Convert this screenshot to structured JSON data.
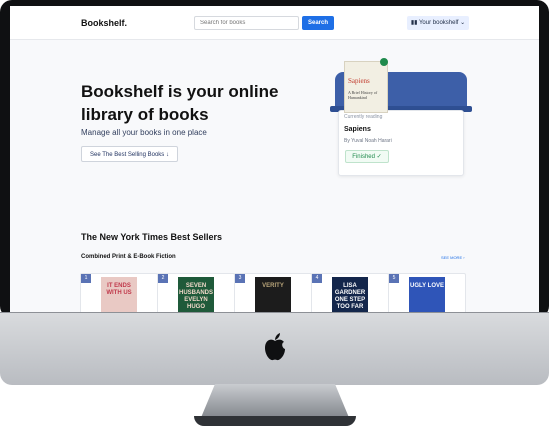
{
  "nav": {
    "logo": "Bookshelf.",
    "search_placeholder": "Search for books",
    "search_button": "Search",
    "account_label": "Your bookshelf"
  },
  "hero": {
    "title": "Bookshelf is your online library of books",
    "subtitle": "Manage all your books in one place",
    "cta": "See The Best Selling Books"
  },
  "currently_reading": {
    "label": "Currently reading",
    "title": "Sapiens",
    "author": "By Yuval Noah Harari",
    "status": "Finished",
    "cover_title": "Sapiens",
    "cover_subtitle": "A Brief History of Humankind"
  },
  "best_sellers": {
    "heading": "The New York Times Best Sellers",
    "list_name": "Combined Print & E-Book Fiction",
    "see_more": "SEE MORE",
    "books": [
      {
        "rank": "1",
        "cover_text": "IT ENDS WITH US",
        "bg": "#e9c9c4",
        "fg": "#c0394b"
      },
      {
        "rank": "2",
        "cover_text": "SEVEN HUSBANDS EVELYN HUGO",
        "bg": "#1f5a3a",
        "fg": "#f0d8c9"
      },
      {
        "rank": "3",
        "cover_text": "VERITY",
        "bg": "#1c1c1c",
        "fg": "#b9a57a"
      },
      {
        "rank": "4",
        "cover_text": "LISA GARDNER ONE STEP TOO FAR",
        "bg": "#13264b",
        "fg": "#ffffff"
      },
      {
        "rank": "5",
        "cover_text": "UGLY LOVE",
        "bg": "#2f55b8",
        "fg": "#ffffff"
      }
    ]
  },
  "colors": {
    "accent": "#1e6fe6",
    "shelf": "#3d5fa8",
    "bezel": "#0f1012"
  }
}
